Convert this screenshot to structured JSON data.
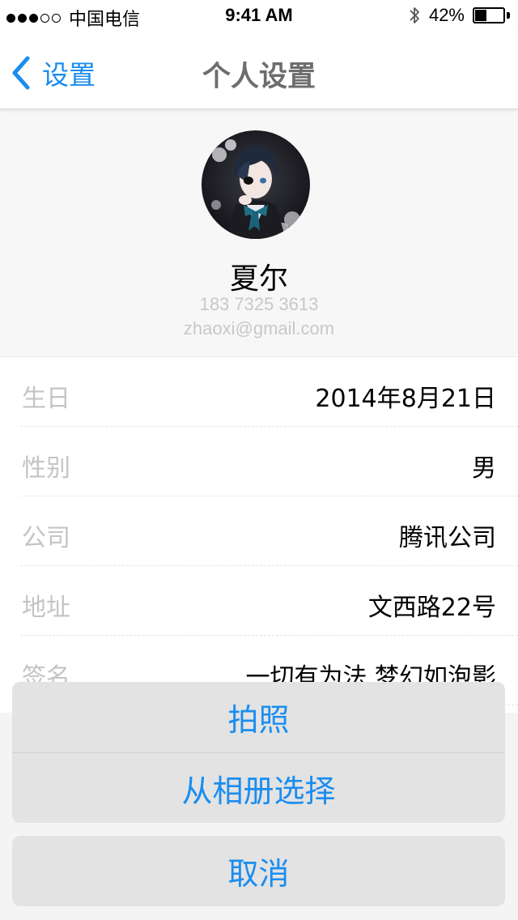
{
  "status_bar": {
    "signal_bars": 3,
    "signal_max": 5,
    "carrier": "中国电信",
    "time": "9:41 AM",
    "battery_percent": "42%",
    "battery_level": 0.42
  },
  "nav": {
    "back_label": "设置",
    "title": "个人设置",
    "accent_color": "#1a8df0"
  },
  "profile": {
    "name": "夏尔",
    "phone": "183 7325 3613",
    "email": "zhaoxi@gmail.com"
  },
  "info_rows": [
    {
      "label": "生日",
      "value": "2014年8月21日"
    },
    {
      "label": "性别",
      "value": "男"
    },
    {
      "label": "公司",
      "value": "腾讯公司"
    },
    {
      "label": "地址",
      "value": "文西路22号"
    },
    {
      "label": "签名",
      "value": "一切有为法 梦幻如泡影"
    }
  ],
  "action_sheet": {
    "take_photo": "拍照",
    "choose_from_album": "从相册选择",
    "cancel": "取消"
  }
}
